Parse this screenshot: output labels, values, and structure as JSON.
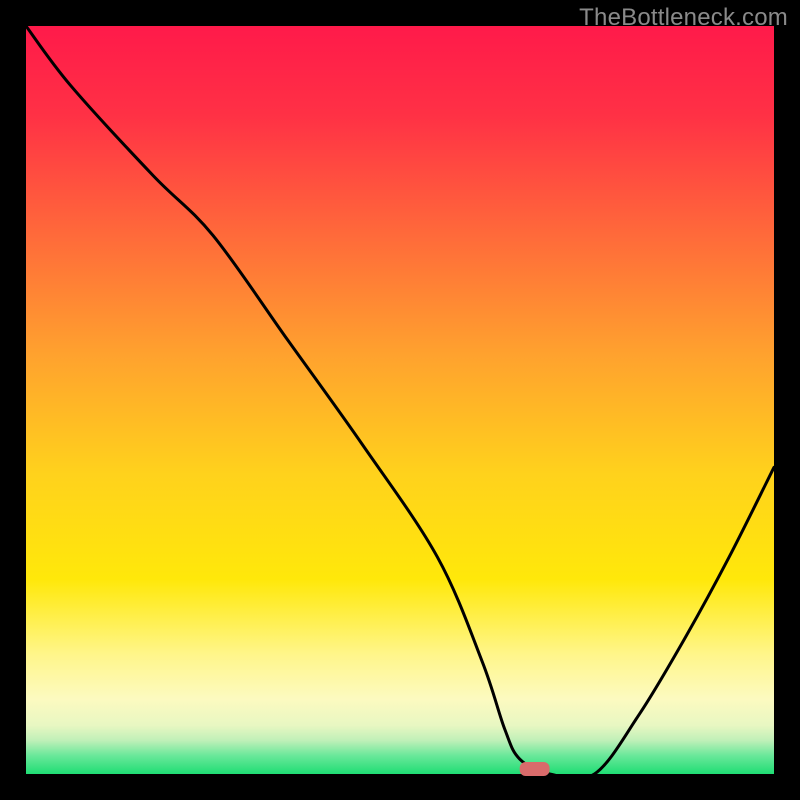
{
  "watermark": "TheBottleneck.com",
  "chart_data": {
    "type": "line",
    "title": "",
    "xlabel": "",
    "ylabel": "",
    "xlim": [
      0,
      100
    ],
    "ylim": [
      0,
      100
    ],
    "x": [
      0,
      6,
      17,
      25,
      35,
      45,
      55,
      61,
      64,
      66,
      70,
      76,
      82,
      88,
      94,
      100
    ],
    "values": [
      100,
      92,
      80,
      72,
      58,
      44,
      29,
      15,
      6,
      2,
      0,
      0,
      8,
      18,
      29,
      41
    ],
    "marker": {
      "x": 68,
      "y": 0,
      "width": 4,
      "height": 2,
      "color": "#d96b6b"
    },
    "gradient_stops": [
      {
        "offset": 0.0,
        "color": "#ff1a4a"
      },
      {
        "offset": 0.12,
        "color": "#ff3145"
      },
      {
        "offset": 0.28,
        "color": "#ff6a3a"
      },
      {
        "offset": 0.44,
        "color": "#ffa22e"
      },
      {
        "offset": 0.6,
        "color": "#ffd21c"
      },
      {
        "offset": 0.74,
        "color": "#ffe80a"
      },
      {
        "offset": 0.84,
        "color": "#fff68a"
      },
      {
        "offset": 0.9,
        "color": "#fcfac0"
      },
      {
        "offset": 0.935,
        "color": "#e8f7c2"
      },
      {
        "offset": 0.955,
        "color": "#c0f0b8"
      },
      {
        "offset": 0.975,
        "color": "#6be89a"
      },
      {
        "offset": 1.0,
        "color": "#1fdd74"
      }
    ]
  }
}
